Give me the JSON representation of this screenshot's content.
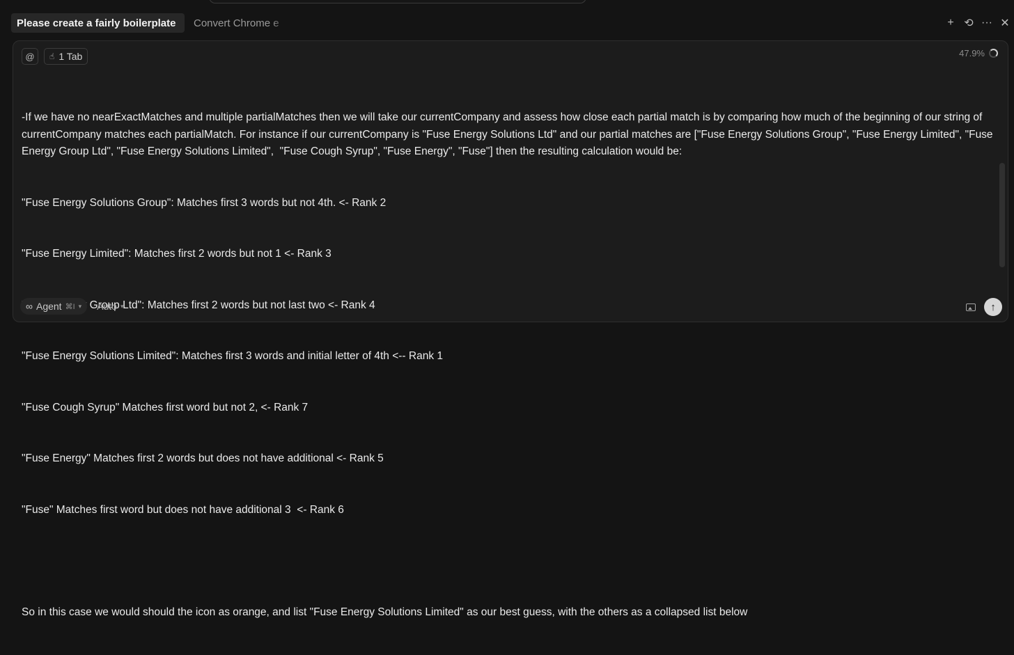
{
  "tabs": [
    {
      "label": "Please create a fairly boilerplate",
      "active": true
    },
    {
      "label": "Convert Chrome e",
      "active": false
    }
  ],
  "tab_actions": {
    "new": "+",
    "history": "⟲",
    "more": "···",
    "close": "✕"
  },
  "composer": {
    "at_symbol": "@",
    "context_chip": "1 Tab",
    "context_percent": "47.9%",
    "lines": [
      "-If we have no nearExactMatches and multiple partialMatches then we will take our currentCompany and assess how close each partial match is by comparing how much of the beginning of our string of currentCompany matches each partialMatch. For instance if our currentCompany is \"Fuse Energy Solutions Ltd\" and our partial matches are [\"Fuse Energy Solutions Group\", \"Fuse Energy Limited\", \"Fuse Energy Group Ltd\", \"Fuse Energy Solutions Limited\",  \"Fuse Cough Syrup\", \"Fuse Energy\", \"Fuse\"] then the resulting calculation would be:",
      "\"Fuse Energy Solutions Group\": Matches first 3 words but not 4th. <- Rank 2",
      "\"Fuse Energy Limited\": Matches first 2 words but not 1 <- Rank 3",
      "\"Fuse Energy Group Ltd\": Matches first 2 words but not last two <- Rank 4",
      "\"Fuse Energy Solutions Limited\": Matches first 3 words and initial letter of 4th <-- Rank 1",
      "\"Fuse Cough Syrup\" Matches first word but not 2, <- Rank 7",
      "\"Fuse Energy\" Matches first 2 words but does not have additional <- Rank 5",
      "\"Fuse\" Matches first word but does not have additional 3  <- Rank 6",
      "",
      "So in this case we would should the icon as orange, and list \"Fuse Energy Solutions Limited\" as our best guess, with the others as a collapsed list below"
    ],
    "mode_label": "Agent",
    "mode_shortcut": "⌘I",
    "model_label": "Auto",
    "send_icon": "↑"
  }
}
